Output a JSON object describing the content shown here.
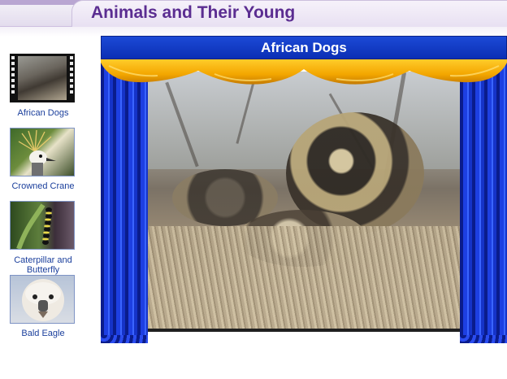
{
  "header": {
    "title": "Animals and Their Young"
  },
  "sidebar": {
    "items": [
      {
        "label": "African Dogs",
        "icon": "film-reel-thumbnail",
        "selected": true
      },
      {
        "label": "Crowned Crane",
        "icon": "crane-thumbnail",
        "selected": false
      },
      {
        "label": "Caterpillar and Butterfly",
        "icon": "caterpillar-thumbnail",
        "selected": false
      },
      {
        "label": "Bald Eagle",
        "icon": "eagle-thumbnail",
        "selected": false
      }
    ]
  },
  "stage": {
    "title": "African Dogs",
    "colors": {
      "title_bar": "#0b2fb4",
      "curtain": "#1d3fe2",
      "valance": "#f5b800",
      "header_text": "#5b2d91",
      "sidebar_text": "#1b3f9c"
    }
  }
}
